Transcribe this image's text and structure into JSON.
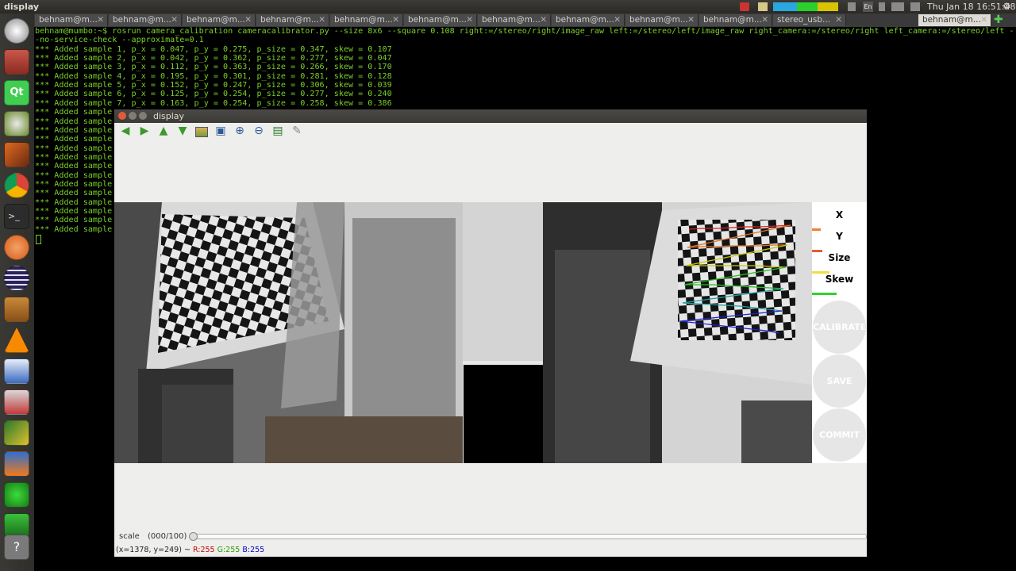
{
  "topbar": {
    "app_title": "display",
    "clock": "Thu Jan 18 16:51:48",
    "lang": "En"
  },
  "launcher": {
    "items": [
      "dash-icon",
      "files-icon",
      "qt-creator-icon",
      "settings-icon",
      "matlab-icon",
      "chrome-icon",
      "terminal-icon",
      "ubuntu-one-icon",
      "eclipse-icon",
      "dictionary-icon",
      "vlc-icon",
      "writer-icon",
      "archive-icon",
      "tool-icon",
      "software-icon",
      "system-monitor-icon",
      "network-icon",
      "stack-icon",
      "help-icon",
      "trash-icon"
    ]
  },
  "tabs": [
    {
      "label": "behnam@m..."
    },
    {
      "label": "behnam@m..."
    },
    {
      "label": "behnam@m..."
    },
    {
      "label": "behnam@m..."
    },
    {
      "label": "behnam@m..."
    },
    {
      "label": "behnam@m..."
    },
    {
      "label": "behnam@m..."
    },
    {
      "label": "behnam@m..."
    },
    {
      "label": "behnam@m..."
    },
    {
      "label": "behnam@m..."
    },
    {
      "label": "stereo_usb..."
    },
    {
      "label": "behnam@m..."
    }
  ],
  "terminal": {
    "command": "behnam@mumbo:~$ rosrun camera_calibration cameracalibrator.py --size 8x6 --square 0.108 right:=/stereo/right/image_raw left:=/stereo/left/image_raw right_camera:=/stereo/right left_camera:=/stereo/left -",
    "command_cont": "-no-service-check --approximate=0.1",
    "samples": [
      "*** Added sample 1, p_x = 0.047, p_y = 0.275, p_size = 0.347, skew = 0.107",
      "*** Added sample 2, p_x = 0.042, p_y = 0.362, p_size = 0.277, skew = 0.047",
      "*** Added sample 3, p_x = 0.112, p_y = 0.363, p_size = 0.266, skew = 0.170",
      "*** Added sample 4, p_x = 0.195, p_y = 0.301, p_size = 0.281, skew = 0.128",
      "*** Added sample 5, p_x = 0.152, p_y = 0.247, p_size = 0.306, skew = 0.039",
      "*** Added sample 6, p_x = 0.125, p_y = 0.254, p_size = 0.277, skew = 0.240",
      "*** Added sample 7, p_x = 0.163, p_y = 0.254, p_size = 0.258, skew = 0.386",
      "*** Added sample",
      "*** Added sample",
      "*** Added sample",
      "*** Added sample",
      "*** Added sample",
      "*** Added sample",
      "*** Added sample",
      "*** Added sample",
      "*** Added sample",
      "*** Added sample",
      "*** Added sample",
      "*** Added sample",
      "*** Added sample",
      "*** Added sample"
    ]
  },
  "window": {
    "title": "display",
    "toolbar": [
      "back-arrow-icon",
      "forward-arrow-icon",
      "up-arrow-icon",
      "down-arrow-icon",
      "image-icon",
      "fit-window-icon",
      "zoom-in-icon",
      "zoom-out-icon",
      "save-icon",
      "brush-icon"
    ],
    "params": {
      "x_label": "X",
      "y_label": "Y",
      "size_label": "Size",
      "skew_label": "Skew",
      "x_progress": 0.25,
      "y_progress": 0.3,
      "size_progress": 0.5,
      "skew_progress": 0.7,
      "calibrate": "CALIBRATE",
      "save": "SAVE",
      "commit": "COMMIT"
    },
    "scale_label": "scale",
    "scale_value": "(000/100)",
    "status": {
      "coords": "(x=1378, y=249) ~",
      "r": "R:255",
      "g": "G:255",
      "b": "B:255"
    }
  },
  "colors": {
    "terminal_text": "#7bd02a",
    "status_r": "#cc0000",
    "status_g": "#2a9d00",
    "status_b": "#0000cc"
  }
}
